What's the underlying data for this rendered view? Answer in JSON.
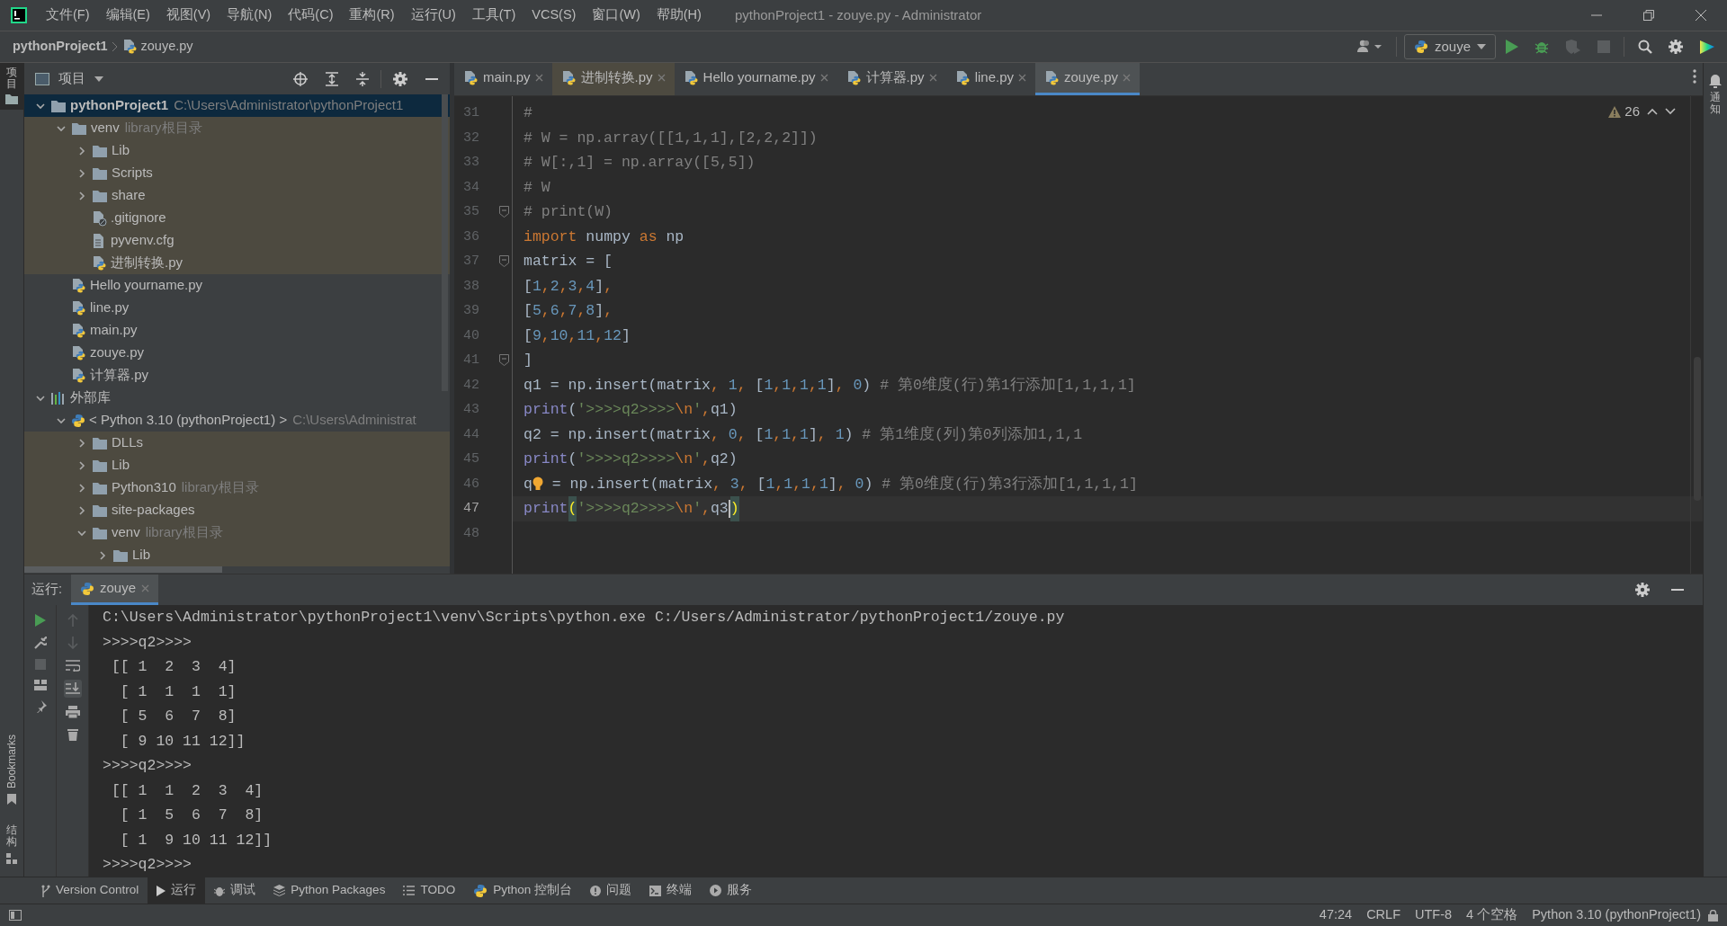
{
  "window": {
    "title": "pythonProject1 - zouye.py - Administrator"
  },
  "menu": [
    "文件(F)",
    "编辑(E)",
    "视图(V)",
    "导航(N)",
    "代码(C)",
    "重构(R)",
    "运行(U)",
    "工具(T)",
    "VCS(S)",
    "窗口(W)",
    "帮助(H)"
  ],
  "breadcrumb": {
    "project": "pythonProject1",
    "file": "zouye.py"
  },
  "run_config": {
    "name": "zouye"
  },
  "left_strip": {
    "top": "项目",
    "bookmarks": "Bookmarks",
    "structure": "结构"
  },
  "right_strip": {
    "label": "通知"
  },
  "project_panel": {
    "title": "项目",
    "tree": [
      {
        "label": "pythonProject1",
        "hint": "C:\\Users\\Administrator\\pythonProject1",
        "kind": "folder",
        "expanded": true,
        "selected": true,
        "tinted": false,
        "children": [
          {
            "label": "venv",
            "hint": "library根目录",
            "kind": "folder",
            "expanded": true,
            "selected": false,
            "tinted": true,
            "children": [
              {
                "label": "Lib",
                "kind": "folder",
                "expanded": false,
                "selected": false,
                "tinted": true
              },
              {
                "label": "Scripts",
                "kind": "folder",
                "expanded": false,
                "selected": false,
                "tinted": true
              },
              {
                "label": "share",
                "kind": "folder",
                "expanded": false,
                "selected": false,
                "tinted": true
              },
              {
                "label": ".gitignore",
                "kind": "ignore",
                "selected": false,
                "tinted": true
              },
              {
                "label": "pyvenv.cfg",
                "kind": "text",
                "selected": false,
                "tinted": true
              },
              {
                "label": "进制转换.py",
                "kind": "python",
                "selected": false,
                "tinted": true
              }
            ]
          },
          {
            "label": "Hello yourname.py",
            "kind": "python",
            "selected": false,
            "tinted": false
          },
          {
            "label": "line.py",
            "kind": "python",
            "selected": false,
            "tinted": false
          },
          {
            "label": "main.py",
            "kind": "python",
            "selected": false,
            "tinted": false
          },
          {
            "label": "zouye.py",
            "kind": "python",
            "selected": false,
            "tinted": false
          },
          {
            "label": "计算器.py",
            "kind": "python",
            "selected": false,
            "tinted": false
          }
        ]
      },
      {
        "label": "外部库",
        "kind": "library",
        "expanded": true,
        "selected": false,
        "tinted": false,
        "children": [
          {
            "label": "< Python 3.10 (pythonProject1) >",
            "hint": "C:\\Users\\Administrat",
            "kind": "sdk",
            "expanded": true,
            "selected": false,
            "tinted": false,
            "children": [
              {
                "label": "DLLs",
                "kind": "folder",
                "expanded": false,
                "selected": false,
                "tinted": true
              },
              {
                "label": "Lib",
                "kind": "folder",
                "expanded": false,
                "selected": false,
                "tinted": true
              },
              {
                "label": "Python310",
                "hint": "library根目录",
                "kind": "folder",
                "expanded": false,
                "selected": false,
                "tinted": true
              },
              {
                "label": "site-packages",
                "kind": "folder",
                "expanded": false,
                "selected": false,
                "tinted": true
              },
              {
                "label": "venv",
                "hint": "library根目录",
                "kind": "folder",
                "expanded": true,
                "selected": false,
                "tinted": true,
                "children": [
                  {
                    "label": "Lib",
                    "kind": "folder",
                    "expanded": false,
                    "selected": false,
                    "tinted": true
                  }
                ]
              }
            ]
          }
        ]
      }
    ]
  },
  "editor_tabs": [
    {
      "label": "main.py",
      "selected": false,
      "tinted": false
    },
    {
      "label": "进制转换.py",
      "selected": false,
      "tinted": true
    },
    {
      "label": "Hello yourname.py",
      "selected": false,
      "tinted": false
    },
    {
      "label": "计算器.py",
      "selected": false,
      "tinted": false
    },
    {
      "label": "line.py",
      "selected": false,
      "tinted": false
    },
    {
      "label": "zouye.py",
      "selected": true,
      "tinted": false
    }
  ],
  "inspections": {
    "warnings": "26"
  },
  "code_lines": [
    {
      "number": "31",
      "current": false,
      "fold": false,
      "tokens": [
        {
          "t": "#",
          "kind": "comment"
        }
      ]
    },
    {
      "number": "32",
      "current": false,
      "fold": false,
      "tokens": [
        {
          "t": "# W = np.array([[1,1,1],[2,2,2]])",
          "kind": "comment"
        }
      ]
    },
    {
      "number": "33",
      "current": false,
      "fold": false,
      "tokens": [
        {
          "t": "# W[:,1] = np.array([5,5])",
          "kind": "comment"
        }
      ]
    },
    {
      "number": "34",
      "current": false,
      "fold": false,
      "tokens": [
        {
          "t": "# W",
          "kind": "comment"
        }
      ]
    },
    {
      "number": "35",
      "current": false,
      "fold": true,
      "tokens": [
        {
          "t": "# print(W)",
          "kind": "comment"
        }
      ]
    },
    {
      "number": "36",
      "current": false,
      "fold": false,
      "tokens": [
        {
          "t": "import",
          "kind": "keyword"
        },
        {
          "t": " numpy ",
          "kind": "plain"
        },
        {
          "t": "as",
          "kind": "keyword"
        },
        {
          "t": " np",
          "kind": "plain"
        }
      ]
    },
    {
      "number": "37",
      "current": false,
      "fold": true,
      "tokens": [
        {
          "t": "matrix = [",
          "kind": "plain"
        }
      ]
    },
    {
      "number": "38",
      "current": false,
      "fold": false,
      "tokens": [
        {
          "t": "[",
          "kind": "plain"
        },
        {
          "t": "1",
          "kind": "number"
        },
        {
          "t": ",",
          "kind": "punct"
        },
        {
          "t": "2",
          "kind": "number"
        },
        {
          "t": ",",
          "kind": "punct"
        },
        {
          "t": "3",
          "kind": "number"
        },
        {
          "t": ",",
          "kind": "punct"
        },
        {
          "t": "4",
          "kind": "number"
        },
        {
          "t": "]",
          "kind": "plain"
        },
        {
          "t": ",",
          "kind": "punct"
        }
      ]
    },
    {
      "number": "39",
      "current": false,
      "fold": false,
      "tokens": [
        {
          "t": "[",
          "kind": "plain"
        },
        {
          "t": "5",
          "kind": "number"
        },
        {
          "t": ",",
          "kind": "punct"
        },
        {
          "t": "6",
          "kind": "number"
        },
        {
          "t": ",",
          "kind": "punct"
        },
        {
          "t": "7",
          "kind": "number"
        },
        {
          "t": ",",
          "kind": "punct"
        },
        {
          "t": "8",
          "kind": "number"
        },
        {
          "t": "]",
          "kind": "plain"
        },
        {
          "t": ",",
          "kind": "punct"
        }
      ]
    },
    {
      "number": "40",
      "current": false,
      "fold": false,
      "tokens": [
        {
          "t": "[",
          "kind": "plain"
        },
        {
          "t": "9",
          "kind": "number"
        },
        {
          "t": ",",
          "kind": "punct"
        },
        {
          "t": "10",
          "kind": "number"
        },
        {
          "t": ",",
          "kind": "punct"
        },
        {
          "t": "11",
          "kind": "number"
        },
        {
          "t": ",",
          "kind": "punct"
        },
        {
          "t": "12",
          "kind": "number"
        },
        {
          "t": "]",
          "kind": "plain"
        }
      ]
    },
    {
      "number": "41",
      "current": false,
      "fold": true,
      "tokens": [
        {
          "t": "]",
          "kind": "plain"
        }
      ]
    },
    {
      "number": "42",
      "current": false,
      "fold": false,
      "tokens": [
        {
          "t": "q1 = np.insert(matrix",
          "kind": "plain"
        },
        {
          "t": ", ",
          "kind": "punct"
        },
        {
          "t": "1",
          "kind": "number"
        },
        {
          "t": ", ",
          "kind": "punct"
        },
        {
          "t": "[",
          "kind": "plain"
        },
        {
          "t": "1",
          "kind": "number"
        },
        {
          "t": ",",
          "kind": "punct"
        },
        {
          "t": "1",
          "kind": "number"
        },
        {
          "t": ",",
          "kind": "punct"
        },
        {
          "t": "1",
          "kind": "number"
        },
        {
          "t": ",",
          "kind": "punct"
        },
        {
          "t": "1",
          "kind": "number"
        },
        {
          "t": "]",
          "kind": "plain"
        },
        {
          "t": ", ",
          "kind": "punct"
        },
        {
          "t": "0",
          "kind": "number"
        },
        {
          "t": ") ",
          "kind": "plain"
        },
        {
          "t": "# 第0维度(行)第1行添加[1,1,1,1]",
          "kind": "comment"
        }
      ]
    },
    {
      "number": "43",
      "current": false,
      "fold": false,
      "tokens": [
        {
          "t": "print",
          "kind": "func"
        },
        {
          "t": "(",
          "kind": "plain"
        },
        {
          "t": "'>>>>q2>>>>",
          "kind": "string"
        },
        {
          "t": "\\n",
          "kind": "keyword"
        },
        {
          "t": "'",
          "kind": "string"
        },
        {
          "t": ",",
          "kind": "punct"
        },
        {
          "t": "q1)",
          "kind": "plain"
        }
      ]
    },
    {
      "number": "44",
      "current": false,
      "fold": false,
      "tokens": [
        {
          "t": "q2 = np.insert(matrix",
          "kind": "plain"
        },
        {
          "t": ", ",
          "kind": "punct"
        },
        {
          "t": "0",
          "kind": "number"
        },
        {
          "t": ", ",
          "kind": "punct"
        },
        {
          "t": "[",
          "kind": "plain"
        },
        {
          "t": "1",
          "kind": "number"
        },
        {
          "t": ",",
          "kind": "punct"
        },
        {
          "t": "1",
          "kind": "number"
        },
        {
          "t": ",",
          "kind": "punct"
        },
        {
          "t": "1",
          "kind": "number"
        },
        {
          "t": "]",
          "kind": "plain"
        },
        {
          "t": ", ",
          "kind": "punct"
        },
        {
          "t": "1",
          "kind": "number"
        },
        {
          "t": ") ",
          "kind": "plain"
        },
        {
          "t": "# 第1维度(列)第0列添加1,1,1",
          "kind": "comment"
        }
      ]
    },
    {
      "number": "45",
      "current": false,
      "fold": false,
      "tokens": [
        {
          "t": "print",
          "kind": "func"
        },
        {
          "t": "(",
          "kind": "plain"
        },
        {
          "t": "'>>>>q2>>>>",
          "kind": "string"
        },
        {
          "t": "\\n",
          "kind": "keyword"
        },
        {
          "t": "'",
          "kind": "string"
        },
        {
          "t": ",",
          "kind": "punct"
        },
        {
          "t": "q2)",
          "kind": "plain"
        }
      ]
    },
    {
      "number": "46",
      "current": false,
      "fold": false,
      "tokens": [
        {
          "t": "q",
          "kind": "plain"
        },
        {
          "kind": "bulb"
        },
        {
          "t": " = np.insert(matrix",
          "kind": "plain"
        },
        {
          "t": ", ",
          "kind": "punct"
        },
        {
          "t": "3",
          "kind": "number"
        },
        {
          "t": ", ",
          "kind": "punct"
        },
        {
          "t": "[",
          "kind": "plain"
        },
        {
          "t": "1",
          "kind": "number"
        },
        {
          "t": ",",
          "kind": "punct"
        },
        {
          "t": "1",
          "kind": "number"
        },
        {
          "t": ",",
          "kind": "punct"
        },
        {
          "t": "1",
          "kind": "number"
        },
        {
          "t": ",",
          "kind": "punct"
        },
        {
          "t": "1",
          "kind": "number"
        },
        {
          "t": "]",
          "kind": "plain"
        },
        {
          "t": ", ",
          "kind": "punct"
        },
        {
          "t": "0",
          "kind": "number"
        },
        {
          "t": ") ",
          "kind": "plain"
        },
        {
          "t": "# 第0维度(行)第3行添加[1,1,1,1]",
          "kind": "comment"
        }
      ]
    },
    {
      "number": "47",
      "current": true,
      "fold": false,
      "tokens": [
        {
          "t": "print",
          "kind": "func"
        },
        {
          "t": "(",
          "kind": "brace"
        },
        {
          "t": "'>>>>q2>>>>",
          "kind": "string"
        },
        {
          "t": "\\n",
          "kind": "keyword"
        },
        {
          "t": "'",
          "kind": "string"
        },
        {
          "t": ",",
          "kind": "punct"
        },
        {
          "t": "q3",
          "kind": "plain"
        },
        {
          "kind": "caret"
        },
        {
          "t": ")",
          "kind": "brace"
        }
      ]
    },
    {
      "number": "48",
      "current": false,
      "fold": false
    }
  ],
  "run_panel": {
    "label": "运行:",
    "tab": "zouye",
    "output": [
      "C:\\Users\\Administrator\\pythonProject1\\venv\\Scripts\\python.exe C:/Users/Administrator/pythonProject1/zouye.py",
      ">>>>q2>>>>",
      " [[ 1  2  3  4]",
      "  [ 1  1  1  1]",
      "  [ 5  6  7  8]",
      "  [ 9 10 11 12]]",
      ">>>>q2>>>>",
      " [[ 1  1  2  3  4]",
      "  [ 1  5  6  7  8]",
      "  [ 1  9 10 11 12]]",
      ">>>>q2>>>>"
    ]
  },
  "tool_tabs": [
    {
      "label": "Version Control",
      "kind": "vcs",
      "selected": false
    },
    {
      "label": "运行",
      "kind": "run",
      "selected": true
    },
    {
      "label": "调试",
      "kind": "debug",
      "selected": false
    },
    {
      "label": "Python Packages",
      "kind": "packages",
      "selected": false
    },
    {
      "label": "TODO",
      "kind": "todo",
      "selected": false
    },
    {
      "label": "Python 控制台",
      "kind": "console",
      "selected": false
    },
    {
      "label": "问题",
      "kind": "problems",
      "selected": false
    },
    {
      "label": "终端",
      "kind": "terminal",
      "selected": false
    },
    {
      "label": "服务",
      "kind": "services",
      "selected": false
    }
  ],
  "status_bar": [
    "47:24",
    "CRLF",
    "UTF-8",
    "4 个空格",
    "Python 3.10 (pythonProject1)"
  ]
}
